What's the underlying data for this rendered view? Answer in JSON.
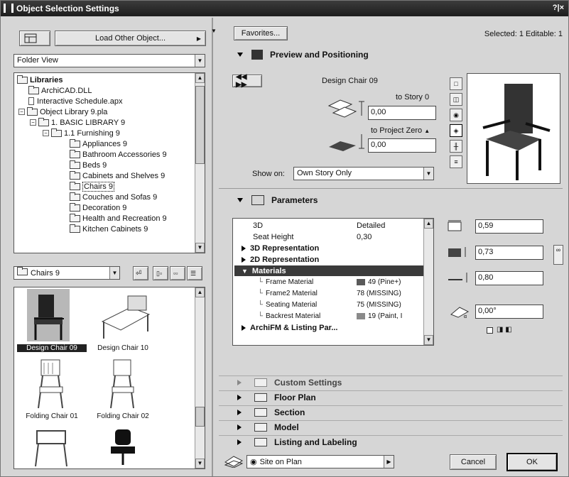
{
  "window": {
    "title": "Object Selection Settings",
    "controls": "?|×"
  },
  "left": {
    "load_button": "Load Other Object...",
    "view_combo": "Folder View",
    "tree": [
      {
        "label": "Libraries",
        "bold": true
      },
      {
        "label": "ArchiCAD.DLL"
      },
      {
        "label": "Interactive Schedule.apx"
      },
      {
        "label": "Object Library 9.pla"
      },
      {
        "label": "1. BASIC LIBRARY 9"
      },
      {
        "label": "1.1 Furnishing 9"
      },
      {
        "label": "Appliances 9"
      },
      {
        "label": "Bathroom Accessories 9"
      },
      {
        "label": "Beds 9"
      },
      {
        "label": "Cabinets and Shelves 9"
      },
      {
        "label": "Chairs 9"
      },
      {
        "label": "Couches and Sofas 9"
      },
      {
        "label": "Decoration 9"
      },
      {
        "label": "Health and Recreation 9"
      },
      {
        "label": "Kitchen Cabinets 9"
      }
    ],
    "folder_combo": "Chairs 9",
    "thumbnails": [
      "Design Chair 09",
      "Design Chair 10",
      "Folding Chair 01",
      "Folding Chair 02",
      "",
      ""
    ]
  },
  "right": {
    "favorites_button": "Favorites...",
    "selection_status": "Selected: 1 Editable: 1",
    "preview": {
      "header": "Preview and Positioning",
      "object_name": "Design Chair 09",
      "to_story_label": "to Story 0",
      "to_story_value": "0,00",
      "to_project_zero_label": "to Project Zero",
      "to_project_zero_value": "0,00",
      "show_on_label": "Show on:",
      "show_on_value": "Own Story Only"
    },
    "parameters": {
      "header": "Parameters",
      "rows": [
        {
          "label": "3D",
          "value": "Detailed"
        },
        {
          "label": "Seat Height",
          "value": "0,30"
        },
        {
          "label": "3D Representation",
          "value": ""
        },
        {
          "label": "2D Representation",
          "value": ""
        },
        {
          "label": "Materials",
          "value": ""
        },
        {
          "label": "Frame Material",
          "value": "49 (Pine+)"
        },
        {
          "label": "Frame2 Material",
          "value": "78 (MISSING)"
        },
        {
          "label": "Seating Material",
          "value": "75 (MISSING)"
        },
        {
          "label": "Backrest Material",
          "value": "19 (Paint, I"
        },
        {
          "label": "ArchiFM & Listing Par...",
          "value": ""
        }
      ],
      "dim_a": "0,59",
      "dim_b": "0,73",
      "dim_height": "0,80",
      "angle": "0,00°"
    },
    "collapsed_sections": [
      "Custom Settings",
      "Floor Plan",
      "Section",
      "Model",
      "Listing and Labeling"
    ],
    "footer": {
      "layer_combo": "Site on Plan",
      "cancel": "Cancel",
      "ok": "OK"
    }
  },
  "colors": {
    "titlebar": "#1d1d1d",
    "selection": "#3a3a3a",
    "frame_swatch": "#5a5a5a",
    "backrest_swatch": "#8a8a8a"
  }
}
